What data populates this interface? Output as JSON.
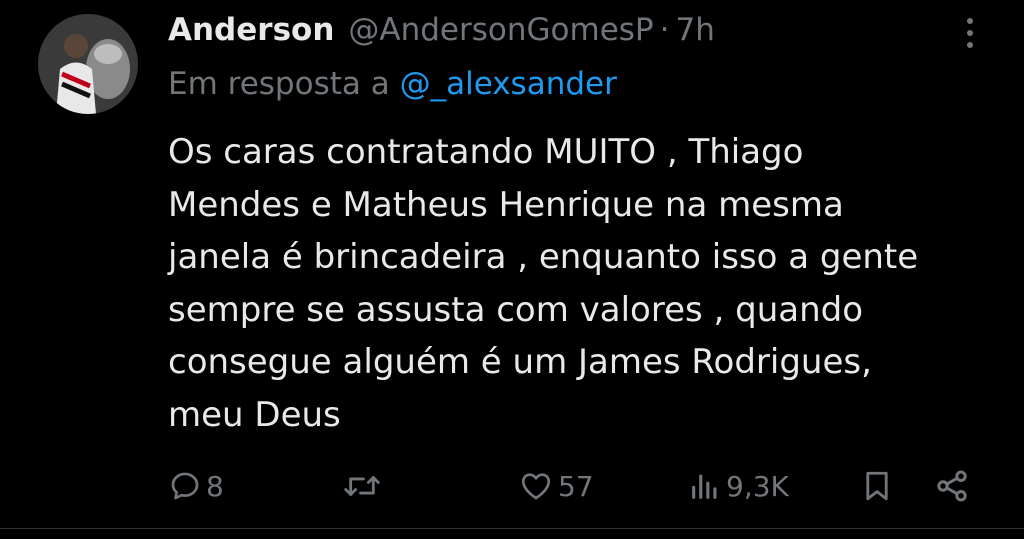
{
  "author": {
    "name": "Anderson",
    "handle": "@AndersonGomesP",
    "separator": "·",
    "time": "7h"
  },
  "reply": {
    "prefix": "Em resposta a ",
    "mention": "@_alexsander"
  },
  "tweet": {
    "lines": [
      "Os caras contratando MUITO , Thiago",
      "Mendes e Matheus Henrique na mesma",
      "janela é brincadeira , enquanto isso a gente",
      "sempre se assusta com valores , quando",
      "consegue alguém é um James Rodrigues,",
      "meu Deus"
    ]
  },
  "actions": {
    "replies": "8",
    "retweets": "",
    "likes": "57",
    "views": "9,3K"
  },
  "colors": {
    "background": "#000000",
    "text": "#e7e9ea",
    "muted": "#71767b",
    "accent": "#1d9bf0"
  },
  "icons": [
    "kebab-menu-icon",
    "reply-icon",
    "retweet-icon",
    "like-icon",
    "views-icon",
    "bookmark-icon",
    "share-icon"
  ]
}
